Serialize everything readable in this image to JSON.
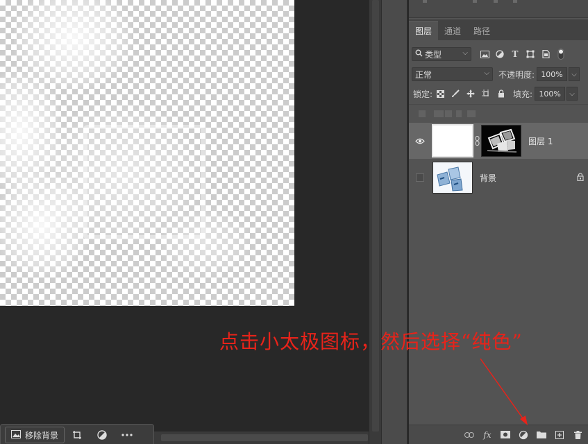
{
  "taskbar": {
    "remove_bg_label": "移除背景",
    "icons": [
      "image-icon",
      "crop-icon",
      "adjust-icon",
      "more-icon"
    ]
  },
  "layers_panel": {
    "tabs": [
      {
        "label": "图层",
        "active": true
      },
      {
        "label": "通道",
        "active": false
      },
      {
        "label": "路径",
        "active": false
      }
    ],
    "filter": {
      "value": "类型",
      "icons": [
        "pixel-filter-icon",
        "adjustment-filter-icon",
        "type-filter-icon",
        "shape-filter-icon",
        "smart-object-filter-icon",
        "filter-toggle-icon"
      ]
    },
    "blend_mode": "正常",
    "opacity_label": "不透明度:",
    "opacity_value": "100%",
    "lock_label": "锁定:",
    "fill_label": "填充:",
    "fill_value": "100%",
    "layers": [
      {
        "name": "图层 1",
        "visible": true,
        "selected": true,
        "has_mask": true,
        "locked": false
      },
      {
        "name": "背景",
        "visible": false,
        "selected": false,
        "has_mask": false,
        "locked": true
      }
    ],
    "bottom_icons": [
      "link-icon",
      "fx-icon",
      "mask-icon",
      "adjustment-layer-icon",
      "group-folder-icon",
      "new-layer-icon",
      "trash-icon"
    ]
  },
  "annotation": {
    "text": "点击小太极图标，然后选择“纯色”",
    "color": "#e8231a"
  },
  "colors": {
    "panel_bg": "#535353",
    "canvas_bg": "#282828",
    "selected_layer": "#676767"
  }
}
